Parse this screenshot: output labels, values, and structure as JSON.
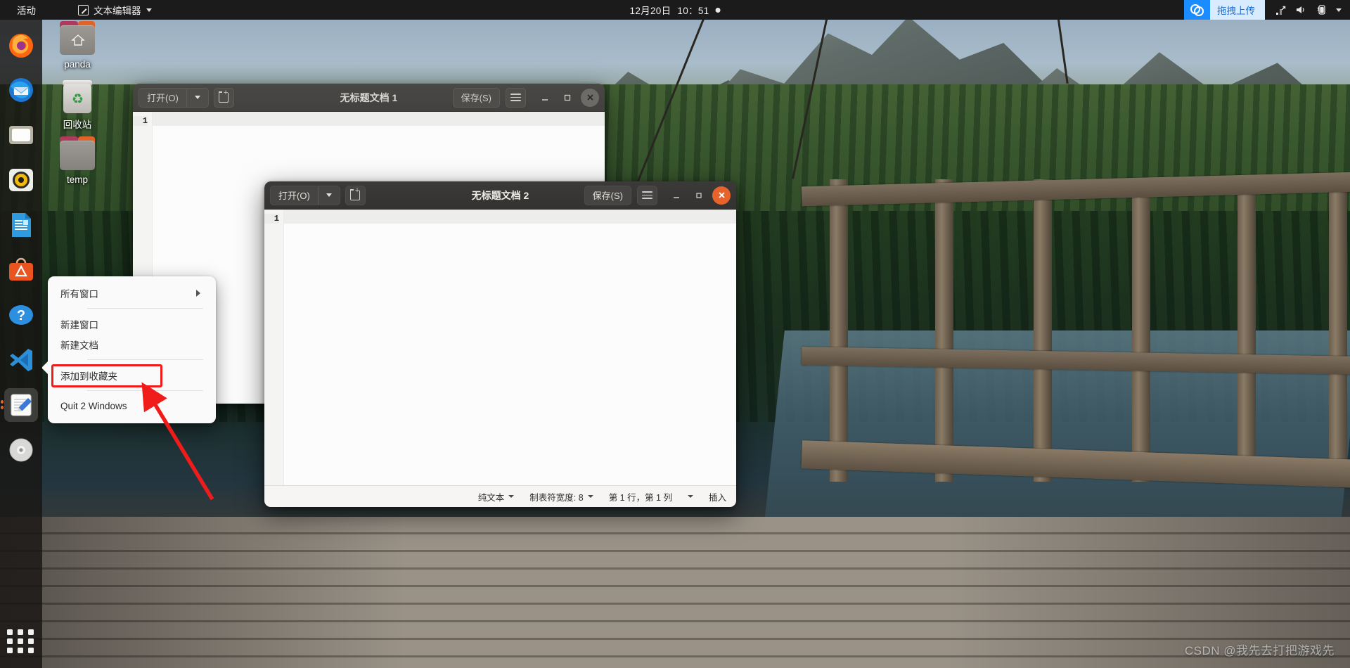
{
  "topbar": {
    "activities": "活动",
    "app_menu": {
      "label": "文本编辑器",
      "icon": "text-editor-icon",
      "caret": "chevron-down-icon"
    },
    "clock": {
      "date": "12月20日",
      "time": "10：51",
      "indicator_icon": "notification-dot-icon"
    },
    "tray": {
      "baidu": {
        "icon": "baidu-netdisk-icon",
        "label": "拖拽上传",
        "accent": "#1a8cff",
        "label_bg": "#d9ecff",
        "label_color": "#1a6fd4"
      },
      "icons": [
        "network-icon",
        "volume-icon",
        "battery-icon",
        "chevron-down-icon"
      ]
    },
    "background": "#1b1b1b"
  },
  "dock": {
    "items": [
      {
        "name": "firefox",
        "icon": "firefox-icon",
        "active": false
      },
      {
        "name": "thunderbird",
        "icon": "thunderbird-icon",
        "active": false
      },
      {
        "name": "files",
        "icon": "files-icon",
        "active": false
      },
      {
        "name": "rhythmbox",
        "icon": "rhythmbox-icon",
        "active": false
      },
      {
        "name": "libreoffice",
        "icon": "libreoffice-writer-icon",
        "active": false
      },
      {
        "name": "ubuntu-software",
        "icon": "ubuntu-software-icon",
        "active": false
      },
      {
        "name": "help",
        "icon": "help-icon",
        "active": false
      },
      {
        "name": "vscode",
        "icon": "vscode-icon",
        "active": false
      },
      {
        "name": "text-editor",
        "icon": "text-editor-icon",
        "active": true
      },
      {
        "name": "disc",
        "icon": "disc-icon",
        "active": false
      }
    ],
    "show_apps": {
      "icon": "app-grid-icon"
    }
  },
  "desktop_icons": [
    {
      "label": "panda",
      "icon": "home-folder-icon"
    },
    {
      "label": "回收站",
      "icon": "trash-icon"
    },
    {
      "label": "temp",
      "icon": "folder-icon"
    }
  ],
  "windows": [
    {
      "id": "window-1",
      "title": "无标题文档 1",
      "active": false,
      "open_label": "打开(O)",
      "open_caret_icon": "chevron-down-icon",
      "new_tab_icon": "new-document-icon",
      "save_label": "保存(S)",
      "menu_icon": "hamburger-menu-icon",
      "minimize_icon": "minimize-icon",
      "maximize_icon": "maximize-icon",
      "close_icon": "close-icon",
      "line_number": "1"
    },
    {
      "id": "window-2",
      "title": "无标题文档 2",
      "active": true,
      "open_label": "打开(O)",
      "open_caret_icon": "chevron-down-icon",
      "new_tab_icon": "new-document-icon",
      "save_label": "保存(S)",
      "menu_icon": "hamburger-menu-icon",
      "minimize_icon": "minimize-icon",
      "maximize_icon": "maximize-icon",
      "close_icon": "close-icon",
      "line_number": "1",
      "statusbar": {
        "syntax": "纯文本",
        "tab_width": "制表符宽度: 8",
        "position": "第 1 行，第 1 列",
        "insert_mode": "插入"
      }
    }
  ],
  "context_menu": {
    "items": [
      {
        "label": "所有窗口",
        "has_submenu": true
      },
      {
        "label": "新建窗口",
        "has_submenu": false
      },
      {
        "label": "新建文档",
        "has_submenu": false
      },
      {
        "label": "添加到收藏夹",
        "has_submenu": false,
        "highlighted": true
      },
      {
        "label": "Quit 2 Windows",
        "has_submenu": false
      }
    ]
  },
  "annotation": {
    "color": "#f01c1c",
    "target": "添加到收藏夹"
  },
  "watermark": "CSDN @我先去打把游戏先"
}
